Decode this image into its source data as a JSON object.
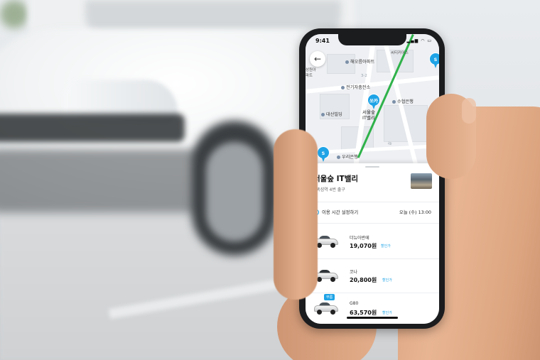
{
  "phone": {
    "status_time": "9:41",
    "status_icons": "▂▄▆ ◠ ▭"
  },
  "map": {
    "labels": {
      "apt": "해오름아파트",
      "ev": "전기자충전소",
      "daesan": "대산빌딩",
      "woori": "우리은행",
      "suhyup": "수협은행",
      "city": "씨티커어스",
      "left1": "성원아",
      "left2": "파트",
      "pin_main_1": "서울숲",
      "pin_main_2": "IT밸리",
      "road_label": "3-2",
      "road_label2": "길"
    },
    "pins": {
      "main": "쏘카",
      "s1": "S",
      "s2": "S"
    }
  },
  "sheet": {
    "title": "서울숲 IT밸리",
    "subtitle": "뚝섬역 4번 출구",
    "time_label": "이용 시간 설정하기",
    "time_value": "오늘 (수) 13:00",
    "cars": [
      {
        "name": "더뉴아반떼",
        "price": "19,070원",
        "discount": "할인가",
        "badge": ""
      },
      {
        "name": "코나",
        "price": "20,800원",
        "discount": "할인가",
        "badge": ""
      },
      {
        "name": "G80",
        "price": "63,570원",
        "discount": "할인가",
        "badge": "부름"
      }
    ]
  }
}
